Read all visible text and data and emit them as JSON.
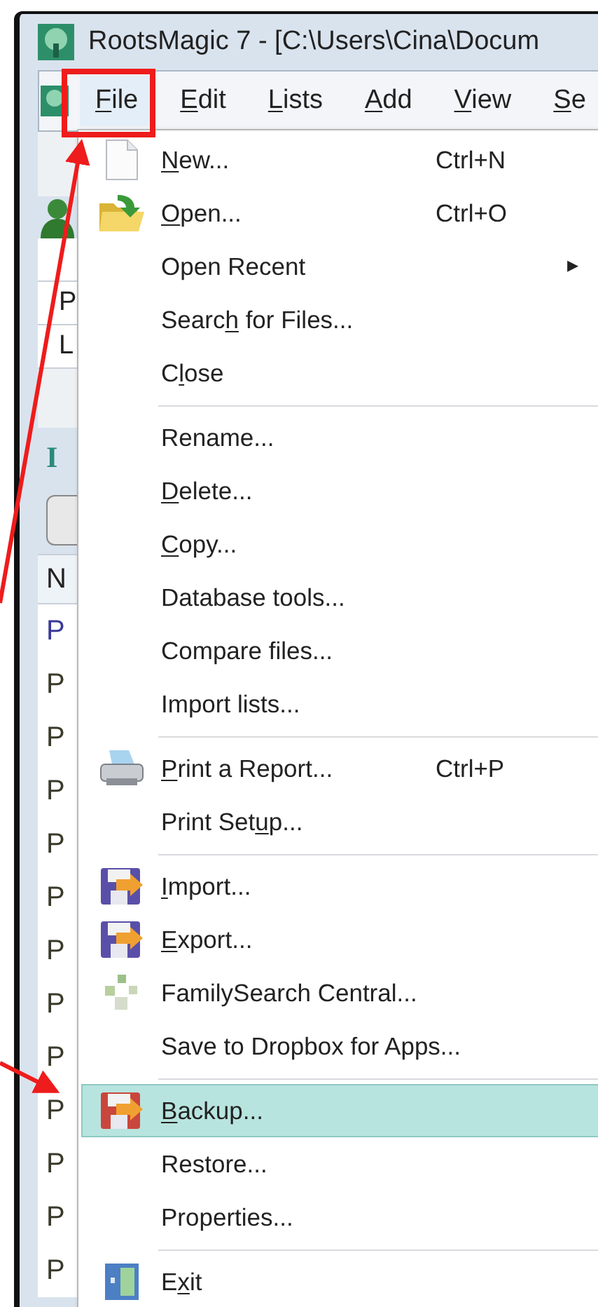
{
  "window": {
    "title": "RootsMagic 7 - [C:\\Users\\Cina\\Docum"
  },
  "menu_bar": [
    {
      "key": "F",
      "post": "ile",
      "selected": true
    },
    {
      "key": "E",
      "post": "dit",
      "selected": false
    },
    {
      "key": "L",
      "post": "ists",
      "selected": false
    },
    {
      "key": "A",
      "post": "dd",
      "selected": false
    },
    {
      "key": "V",
      "post": "iew",
      "selected": false
    },
    {
      "key": "S",
      "post": "e",
      "selected": false
    }
  ],
  "background": {
    "fields": [
      "P",
      "L"
    ],
    "heading": "I",
    "column_1": "N",
    "rows": [
      {
        "text": "P",
        "color": "#3a3a9a"
      },
      {
        "text": "P",
        "color": "#3a3a2a"
      },
      {
        "text": "P",
        "color": "#3a3a2a"
      },
      {
        "text": "P",
        "color": "#3a3a2a"
      },
      {
        "text": "P",
        "color": "#3a3a2a"
      },
      {
        "text": "P",
        "color": "#3a3a2a"
      },
      {
        "text": "P",
        "color": "#3a3a2a"
      },
      {
        "text": "P",
        "color": "#3a3a2a"
      },
      {
        "text": "P",
        "color": "#3a3a2a"
      },
      {
        "text": "P",
        "color": "#3a3a2a"
      },
      {
        "text": "P",
        "color": "#3a3a2a"
      },
      {
        "text": "P",
        "color": "#3a3a2a"
      },
      {
        "text": "P",
        "color": "#3a3a2a"
      }
    ]
  },
  "file_menu": [
    {
      "kind": "item",
      "key": "N",
      "post": "ew...",
      "shortcut": "Ctrl+N",
      "selected": false
    },
    {
      "kind": "item",
      "key": "O",
      "post": "pen...",
      "shortcut": "Ctrl+O",
      "selected": false
    },
    {
      "kind": "submenu",
      "pre": "Open Recent",
      "arrow": "▸",
      "selected": false
    },
    {
      "kind": "item",
      "pre": "Searc",
      "key": "h",
      "post": " for Files...",
      "selected": false
    },
    {
      "kind": "item",
      "pre": "C",
      "key": "l",
      "post": "ose",
      "selected": false
    },
    {
      "kind": "separator"
    },
    {
      "kind": "item",
      "pre": "Rename...",
      "selected": false
    },
    {
      "kind": "item",
      "key": "D",
      "post": "elete...",
      "selected": false
    },
    {
      "kind": "item",
      "key": "C",
      "post": "opy...",
      "selected": false
    },
    {
      "kind": "item",
      "pre": "Database tools...",
      "selected": false
    },
    {
      "kind": "item",
      "pre": "Compare files...",
      "selected": false
    },
    {
      "kind": "item",
      "pre": "Import lists...",
      "selected": false
    },
    {
      "kind": "separator"
    },
    {
      "kind": "item",
      "key": "P",
      "post": "rint a Report...",
      "shortcut": "Ctrl+P",
      "selected": false
    },
    {
      "kind": "item",
      "pre": "Print Set",
      "key": "u",
      "post": "p...",
      "selected": false
    },
    {
      "kind": "separator"
    },
    {
      "kind": "item",
      "key": "I",
      "post": "mport...",
      "selected": false
    },
    {
      "kind": "item",
      "key": "E",
      "post": "xport...",
      "selected": false
    },
    {
      "kind": "item",
      "pre": "FamilySearch Central...",
      "selected": false
    },
    {
      "kind": "item",
      "pre": "Save to Dropbox for Apps...",
      "selected": false
    },
    {
      "kind": "separator"
    },
    {
      "kind": "item",
      "key": "B",
      "post": "ackup...",
      "selected": true
    },
    {
      "kind": "item",
      "pre": "Restore...",
      "selected": false
    },
    {
      "kind": "item",
      "pre": "Properties...",
      "selected": false
    },
    {
      "kind": "separator"
    },
    {
      "kind": "item",
      "pre": "E",
      "key": "x",
      "post": "it",
      "selected": false
    }
  ]
}
